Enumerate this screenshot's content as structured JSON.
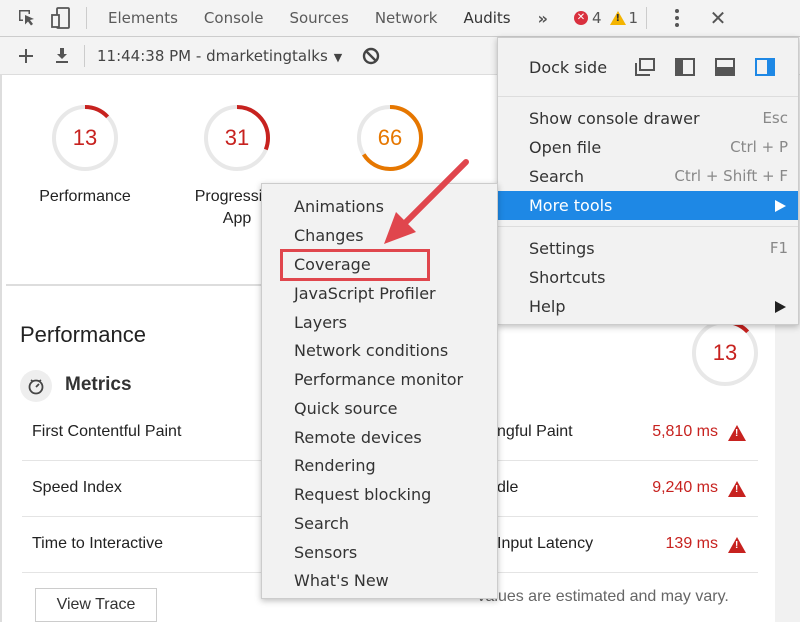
{
  "toolbar": {
    "tabs": [
      "Elements",
      "Console",
      "Sources",
      "Network",
      "Audits"
    ],
    "active_tab": "Audits",
    "more_tabs_glyph": "»",
    "error_count": "4",
    "warning_count": "1",
    "close_glyph": "✕"
  },
  "subbar": {
    "report_label": "11:44:38 PM - dmarketingtalks",
    "caret": "▼"
  },
  "scores": [
    {
      "value": 13,
      "label": "Performance",
      "color": "#c7221f"
    },
    {
      "value": 31,
      "label": "Progressive Web App",
      "label_line1": "Progressive",
      "label_line2": "App",
      "color": "#c7221f"
    },
    {
      "value": 66,
      "label": "",
      "color": "#e67700"
    }
  ],
  "performance": {
    "title": "Performance",
    "score": 13,
    "metrics_title": "Metrics",
    "rows": [
      {
        "left": "First Contentful Paint",
        "right_name": "ngful Paint",
        "right_value": "5,810 ms"
      },
      {
        "left": "Speed Index",
        "right_name": "dle",
        "right_value": "9,240 ms"
      },
      {
        "left": "Time to Interactive",
        "right_name": "Input Latency",
        "right_value": "139 ms"
      }
    ],
    "view_trace_label": "View Trace",
    "estimate_note": "Values are estimated and may vary."
  },
  "main_menu": {
    "dock_label": "Dock side",
    "dock_options": [
      "undock-icon",
      "dock-left-icon",
      "dock-bottom-icon",
      "dock-right-icon"
    ],
    "dock_selected": "dock-right-icon",
    "accent_color": "#1e88e5",
    "items": [
      {
        "label": "Show console drawer",
        "shortcut": "Esc"
      },
      {
        "label": "Open file",
        "shortcut": "Ctrl + P"
      },
      {
        "label": "Search",
        "shortcut": "Ctrl + Shift + F"
      },
      {
        "label": "More tools",
        "shortcut": "",
        "submenu": true,
        "highlighted": true
      },
      {
        "label": "Settings",
        "shortcut": "F1"
      },
      {
        "label": "Shortcuts",
        "shortcut": ""
      },
      {
        "label": "Help",
        "shortcut": "",
        "submenu": true
      }
    ]
  },
  "more_tools_menu": {
    "items": [
      "Animations",
      "Changes",
      "Coverage",
      "JavaScript Profiler",
      "Layers",
      "Network conditions",
      "Performance monitor",
      "Quick source",
      "Remote devices",
      "Rendering",
      "Request blocking",
      "Search",
      "Sensors",
      "What's New"
    ],
    "annotated_item": "Coverage",
    "annotation_color": "#e0464d"
  }
}
